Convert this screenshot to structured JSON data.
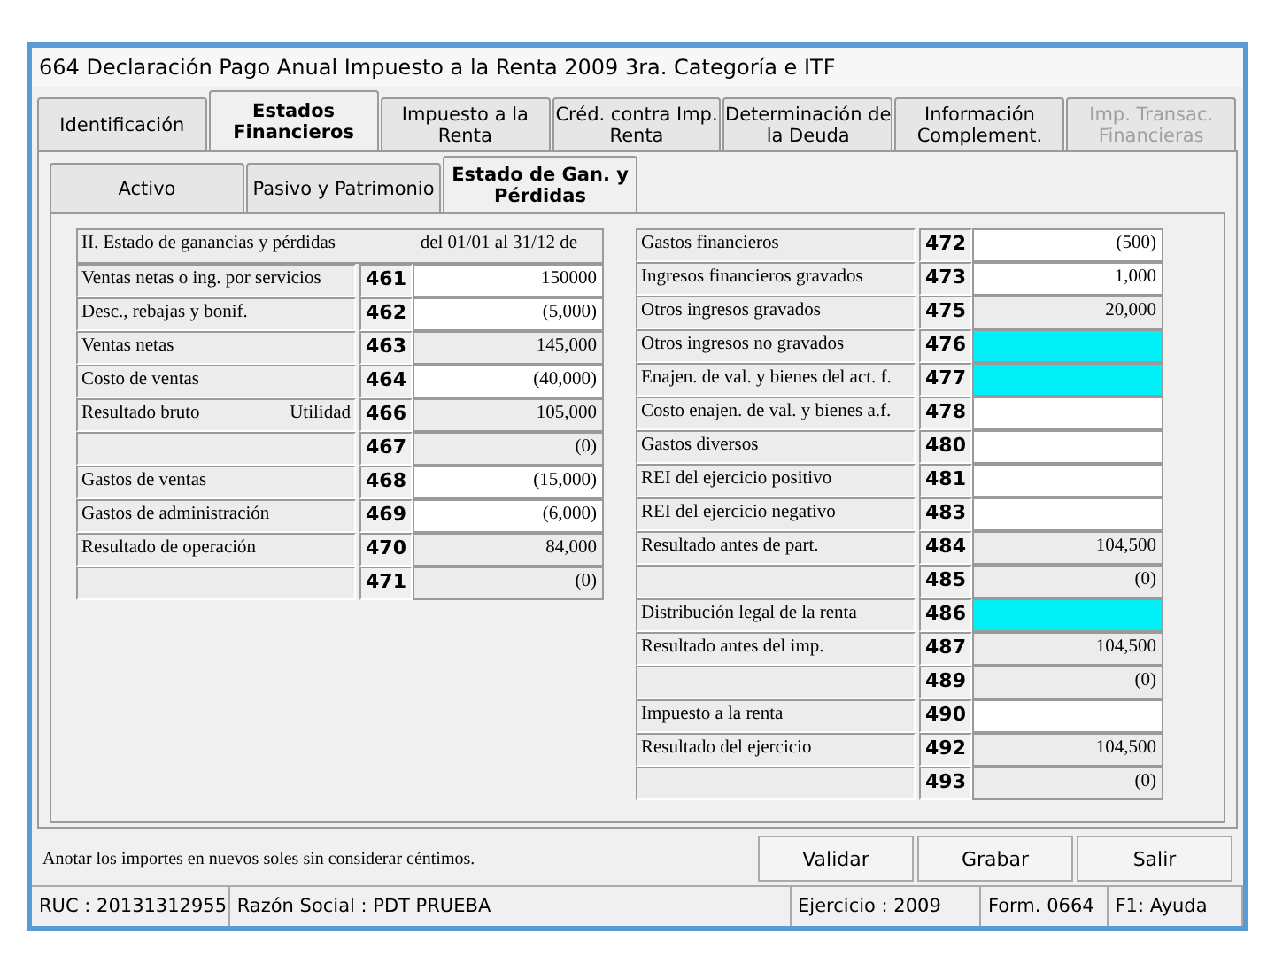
{
  "window": {
    "title": "664 Declaración Pago Anual Impuesto a la Renta 2009 3ra. Categoría e ITF"
  },
  "tabs": [
    {
      "label": "Identificación",
      "selected": false,
      "disabled": false
    },
    {
      "label": "Estados Financieros",
      "selected": true,
      "disabled": false
    },
    {
      "label": "Impuesto a la Renta",
      "selected": false,
      "disabled": false
    },
    {
      "label": "Créd. contra Imp. Renta",
      "selected": false,
      "disabled": false
    },
    {
      "label": "Determinación de la Deuda",
      "selected": false,
      "disabled": false
    },
    {
      "label": "Información Complement.",
      "selected": false,
      "disabled": false
    },
    {
      "label": "Imp. Transac. Financieras",
      "selected": false,
      "disabled": true
    }
  ],
  "subtabs": [
    {
      "label": "Activo",
      "selected": false
    },
    {
      "label": "Pasivo y Patrimonio",
      "selected": false
    },
    {
      "label": "Estado de Gan. y Pérdidas",
      "selected": true
    }
  ],
  "left_header": {
    "title": "II. Estado de ganancias y pérdidas",
    "period": "del 01/01 al 31/12 de"
  },
  "left_rows": [
    {
      "label": "Ventas netas o ing. por servicios",
      "code": "461",
      "value": "150000",
      "kind": "input"
    },
    {
      "label": "Desc., rebajas y bonif.",
      "code": "462",
      "value": "(5,000)",
      "kind": "input"
    },
    {
      "label": "Ventas netas",
      "code": "463",
      "value": "145,000",
      "kind": "computed"
    },
    {
      "label": "Costo de ventas",
      "code": "464",
      "value": "(40,000)",
      "kind": "input"
    },
    {
      "label": "Resultado bruto",
      "note": "Utilidad",
      "code": "466",
      "value": "105,000",
      "kind": "computed"
    },
    {
      "code": "467",
      "value": "(0)",
      "kind": "computed"
    },
    {
      "label": "Gastos de ventas",
      "code": "468",
      "value": "(15,000)",
      "kind": "input"
    },
    {
      "label": "Gastos de administración",
      "code": "469",
      "value": "(6,000)",
      "kind": "input"
    },
    {
      "label": "Resultado de operación",
      "code": "470",
      "value": "84,000",
      "kind": "computed"
    },
    {
      "code": "471",
      "value": "(0)",
      "kind": "computed"
    }
  ],
  "right_rows": [
    {
      "label": "Gastos financieros",
      "code": "472",
      "value": "(500)",
      "kind": "input"
    },
    {
      "label": "Ingresos financieros gravados",
      "code": "473",
      "value": "1,000",
      "kind": "input"
    },
    {
      "label": "Otros ingresos gravados",
      "code": "475",
      "value": "20,000",
      "kind": "computed"
    },
    {
      "label": "Otros ingresos no gravados",
      "code": "476",
      "kind": "highlight"
    },
    {
      "label": "Enajen. de val. y bienes del act. f.",
      "code": "477",
      "kind": "highlight"
    },
    {
      "label": "Costo enajen. de val. y bienes a.f.",
      "code": "478",
      "kind": "input"
    },
    {
      "label": "Gastos diversos",
      "code": "480",
      "kind": "input"
    },
    {
      "label": "REI del ejercicio positivo",
      "code": "481",
      "kind": "input"
    },
    {
      "label": "REI del ejercicio negativo",
      "code": "483",
      "kind": "input"
    },
    {
      "label": "Resultado antes de part.",
      "code": "484",
      "value": "104,500",
      "kind": "computed"
    },
    {
      "code": "485",
      "value": "(0)",
      "kind": "computed"
    },
    {
      "label": "Distribución legal de la renta",
      "code": "486",
      "kind": "highlight"
    },
    {
      "label": "Resultado antes del imp.",
      "code": "487",
      "value": "104,500",
      "kind": "computed"
    },
    {
      "code": "489",
      "value": "(0)",
      "kind": "computed"
    },
    {
      "label": "Impuesto a la renta",
      "code": "490",
      "kind": "input"
    },
    {
      "label": "Resultado del ejercicio",
      "code": "492",
      "value": "104,500",
      "kind": "computed"
    },
    {
      "code": "493",
      "value": "(0)",
      "kind": "computed"
    }
  ],
  "note": "Anotar los importes en nuevos soles sin considerar céntimos.",
  "buttons": [
    "Validar",
    "Grabar",
    "Salir"
  ],
  "status_bar": [
    "RUC : 20131312955",
    "Razón Social : PDT PRUEBA",
    "Ejercicio : 2009",
    "Form. 0664",
    "F1: Ayuda"
  ]
}
